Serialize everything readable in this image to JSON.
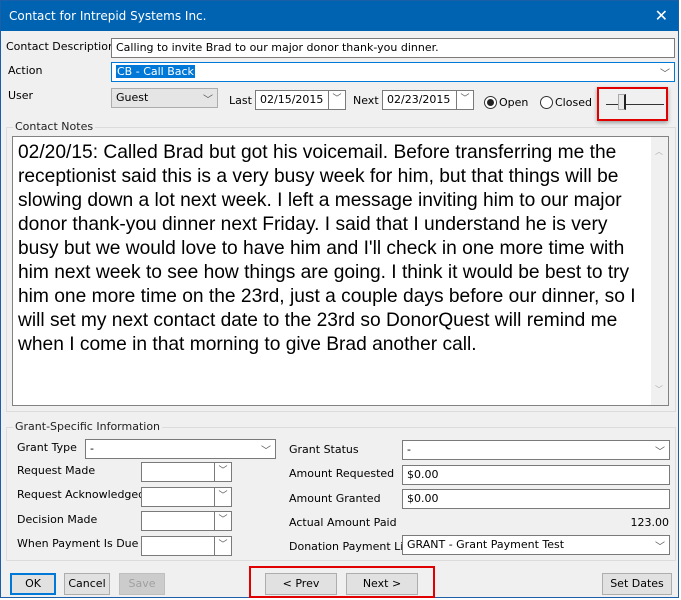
{
  "window": {
    "title": "Contact for Intrepid Systems Inc.",
    "close_icon": "close-icon"
  },
  "header": {
    "description_label": "Contact Description",
    "description_value": "Calling to invite Brad to our major donor thank-you dinner.",
    "action_label": "Action",
    "action_value": "CB - Call Back",
    "user_label": "User",
    "user_value": "Guest",
    "last_label": "Last",
    "last_date": "02/15/2015",
    "next_label": "Next",
    "next_date": "02/23/2015",
    "status_options": [
      {
        "label": "Open",
        "selected": true
      },
      {
        "label": "Closed",
        "selected": false
      }
    ],
    "slider_icon": "text-size-slider"
  },
  "notes": {
    "group_title": "Contact Notes",
    "text": "02/20/15: Called Brad but got his voicemail.  Before transferring me the receptionist said this is a very busy week for him, but that things will be slowing down a lot next week.  I left a message inviting him to our major donor thank-you dinner next Friday.  I said that I understand he is very busy but we would love to have him and I'll check in one more time with him next week to see how things are going.  I think it would be best to try him one more time on the 23rd, just a couple days before our dinner, so I will set my next contact date to the 23rd so DonorQuest will remind me when I come in that morning to give Brad another call."
  },
  "grant": {
    "group_title": "Grant-Specific Information",
    "grant_type_label": "Grant Type",
    "grant_type_value": "-",
    "request_made_label": "Request Made",
    "request_made_value": "",
    "request_ack_label": "Request Acknowledged",
    "request_ack_value": "",
    "decision_made_label": "Decision Made",
    "decision_made_value": "",
    "payment_due_label": "When Payment Is Due",
    "payment_due_value": "",
    "grant_status_label": "Grant Status",
    "grant_status_value": "-",
    "amount_requested_label": "Amount Requested",
    "amount_requested_value": "$0.00",
    "amount_granted_label": "Amount Granted",
    "amount_granted_value": "$0.00",
    "actual_paid_label": "Actual Amount Paid",
    "actual_paid_value": "123.00",
    "payment_link_label": "Donation Payment Link",
    "payment_link_value": "GRANT - Grant Payment Test"
  },
  "footer": {
    "ok_label": "OK",
    "cancel_label": "Cancel",
    "save_label": "Save",
    "prev_label": "< Prev",
    "next_label": "Next >",
    "set_dates_label": "Set Dates"
  }
}
